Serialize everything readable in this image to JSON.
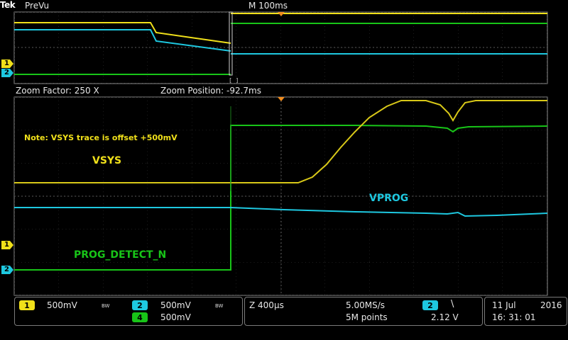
{
  "header": {
    "brand": "Tek",
    "mode": "PreVu",
    "timebase": "M 100ms"
  },
  "zoom": {
    "factor": "Zoom Factor: 250 X",
    "position": "Zoom Position: -92.7ms"
  },
  "annotations": {
    "note": "Note: VSYS trace is offset +500mV",
    "vsys": "VSYS",
    "vprog": "VPROG",
    "prog_detect": "PROG_DETECT_N"
  },
  "markers": {
    "ch1": "1",
    "ch2": "2"
  },
  "channels": [
    {
      "number": "1",
      "scale": "500mV",
      "bw": "BW",
      "color": "#f0e01a"
    },
    {
      "number": "2",
      "scale": "500mV",
      "bw": "BW",
      "color": "#1ec8e0"
    },
    {
      "number": "4",
      "scale": "500mV",
      "color": "#18c418"
    }
  ],
  "acquisition": {
    "zoom_scale": "Z 400µs",
    "sample_rate": "5.00MS/s",
    "record_length": "5M points",
    "trigger_channel": "2",
    "trigger_slope": "\\",
    "trigger_level": "2.12 V"
  },
  "datetime": {
    "date_day_month": "11 Jul",
    "year": "2016",
    "time": "16: 31: 01"
  },
  "colors": {
    "ch1": "#f0e01a",
    "ch2": "#1ec8e0",
    "ch4": "#18c418",
    "trigger_marker": "#f08c1e"
  }
}
